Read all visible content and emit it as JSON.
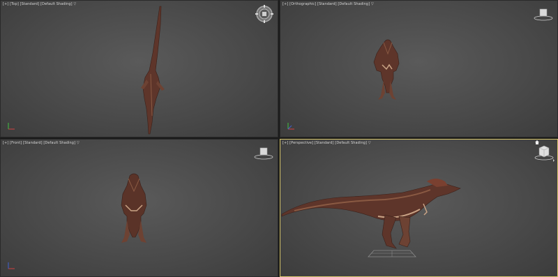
{
  "viewports": {
    "top": {
      "label": "[+] [Top] [Standard] [Default Shading] ▽"
    },
    "ortho": {
      "label": "[+] [Orthographic] [Standard] [Default Shading] ▽"
    },
    "front": {
      "label": "[+] [Front] [Standard] [Default Shading] ▽"
    },
    "persp": {
      "label": "[+] [Perspective] [Standard] [Default Shading] ▽"
    }
  },
  "active_viewport": "persp",
  "icons": {
    "steering_wheel": "steering-wheel-icon",
    "viewcube": "viewcube-icon",
    "axis_tripod": "axis-tripod-icon"
  },
  "colors": {
    "active_border": "#d6c56a",
    "viewport_bg": "#4a4a4a",
    "dino_body": "#6b3b2c"
  }
}
